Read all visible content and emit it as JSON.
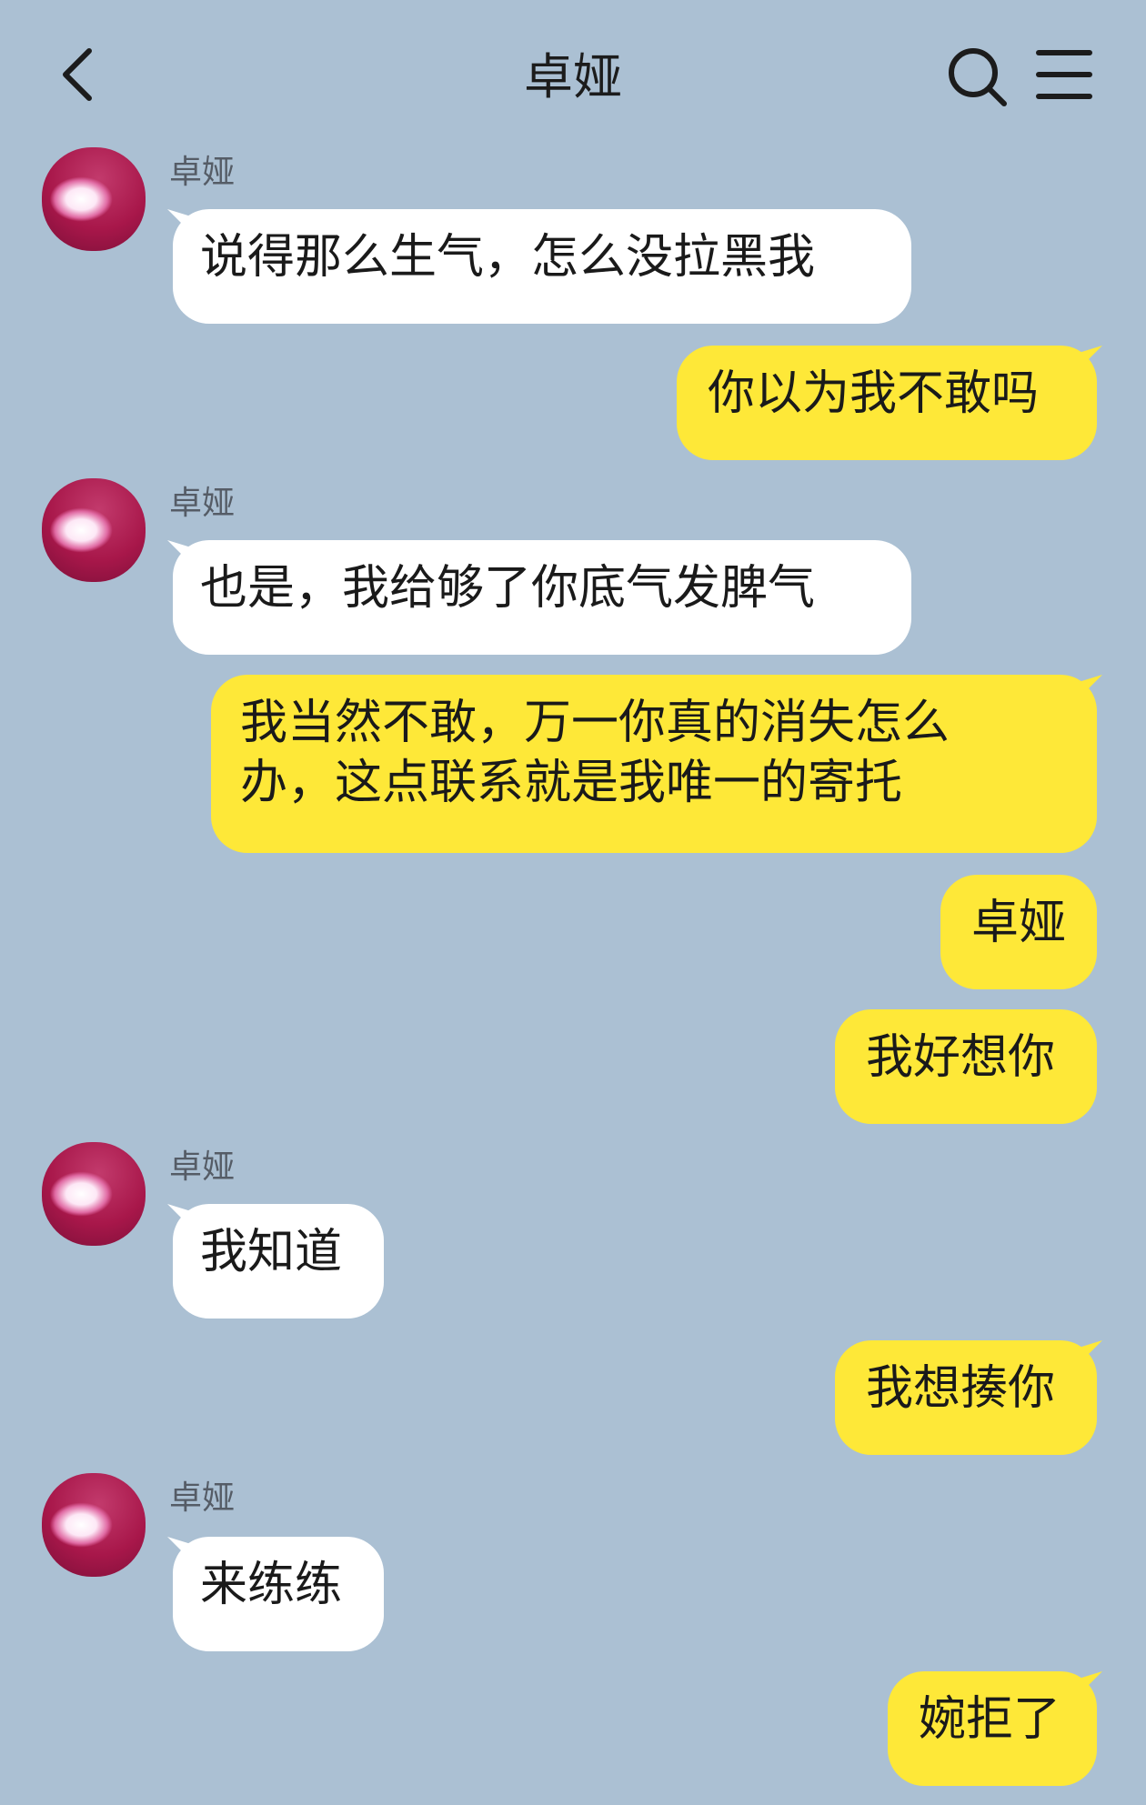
{
  "header": {
    "title": "卓娅",
    "back_icon": "chevron-left-icon",
    "search_icon": "search-icon",
    "menu_icon": "hamburger-menu-icon"
  },
  "colors": {
    "background": "#abc0d3",
    "incoming_bubble": "#ffffff",
    "outgoing_bubble": "#fee838"
  },
  "messages": [
    {
      "direction": "in",
      "sender": "卓娅",
      "text": "说得那么生气，怎么没拉黑我"
    },
    {
      "direction": "out",
      "text": "你以为我不敢吗"
    },
    {
      "direction": "in",
      "sender": "卓娅",
      "text": "也是，我给够了你底气发脾气"
    },
    {
      "direction": "out",
      "text": "我当然不敢，万一你真的消失怎么\n办，这点联系就是我唯一的寄托"
    },
    {
      "direction": "out",
      "text": "卓娅"
    },
    {
      "direction": "out",
      "text": "我好想你"
    },
    {
      "direction": "in",
      "sender": "卓娅",
      "text": "我知道"
    },
    {
      "direction": "out",
      "text": "我想揍你"
    },
    {
      "direction": "in",
      "sender": "卓娅",
      "text": "来练练"
    },
    {
      "direction": "out",
      "text": "婉拒了"
    }
  ]
}
